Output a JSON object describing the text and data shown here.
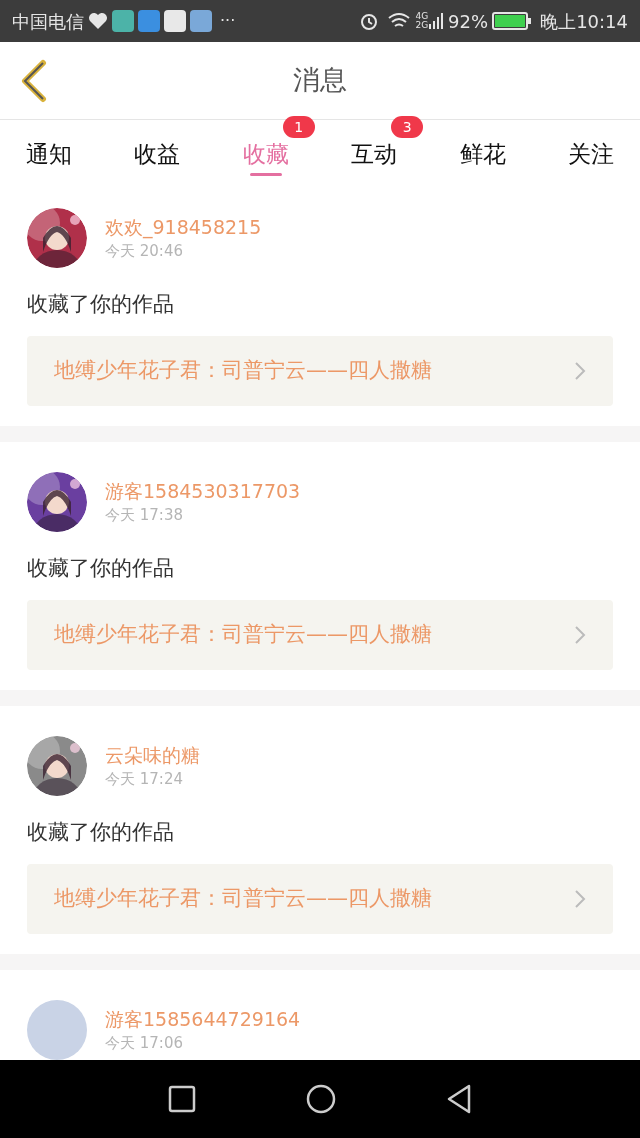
{
  "status_bar": {
    "carrier": "中国电信",
    "more": "···",
    "network": [
      "4G",
      "2G"
    ],
    "battery": "92%",
    "time": "晚上10:14"
  },
  "header": {
    "title": "消息"
  },
  "tabs": [
    {
      "label": "通知",
      "selected": false
    },
    {
      "label": "收益",
      "selected": false
    },
    {
      "label": "收藏",
      "selected": true,
      "badge": "1"
    },
    {
      "label": "互动",
      "selected": false,
      "badge": "3"
    },
    {
      "label": "鲜花",
      "selected": false
    },
    {
      "label": "关注",
      "selected": false
    }
  ],
  "messages": [
    {
      "name": "欢欢_918458215",
      "time": "今天 20:46",
      "action": "收藏了你的作品",
      "work": "地缚少年花子君：司普宁云——四人撒糖"
    },
    {
      "name": "游客1584530317703",
      "time": "今天 17:38",
      "action": "收藏了你的作品",
      "work": "地缚少年花子君：司普宁云——四人撒糖"
    },
    {
      "name": "云朵味的糖",
      "time": "今天 17:24",
      "action": "收藏了你的作品",
      "work": "地缚少年花子君：司普宁云——四人撒糖"
    },
    {
      "avatar": {
        "kind": "default",
        "color": "#c9d3e6"
      },
      "name": "游客1585644729164",
      "time": "今天 17:06"
    }
  ]
}
